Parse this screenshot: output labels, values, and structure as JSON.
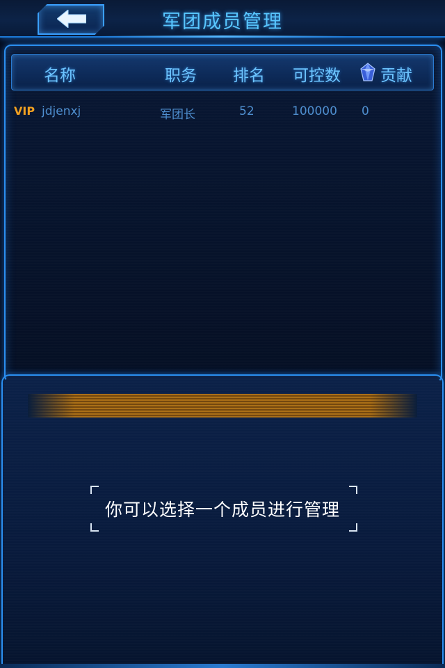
{
  "header": {
    "title": "军团成员管理",
    "back_icon": "back-arrow-icon"
  },
  "table": {
    "columns": [
      "名称",
      "职务",
      "排名",
      "可控数",
      "贡献"
    ],
    "contribution_icon": "crystal-icon",
    "rows": [
      {
        "vip": "VIP",
        "name": "jdjenxj",
        "role": "军团长",
        "rank": "52",
        "controllable": "100000",
        "contribution": "0"
      }
    ]
  },
  "info": {
    "hint": "你可以选择一个成员进行管理"
  },
  "colors": {
    "accent": "#2b8ff0",
    "title": "#58c6ff",
    "vip": "#f0a021",
    "row_text": "#4f8fd0"
  }
}
